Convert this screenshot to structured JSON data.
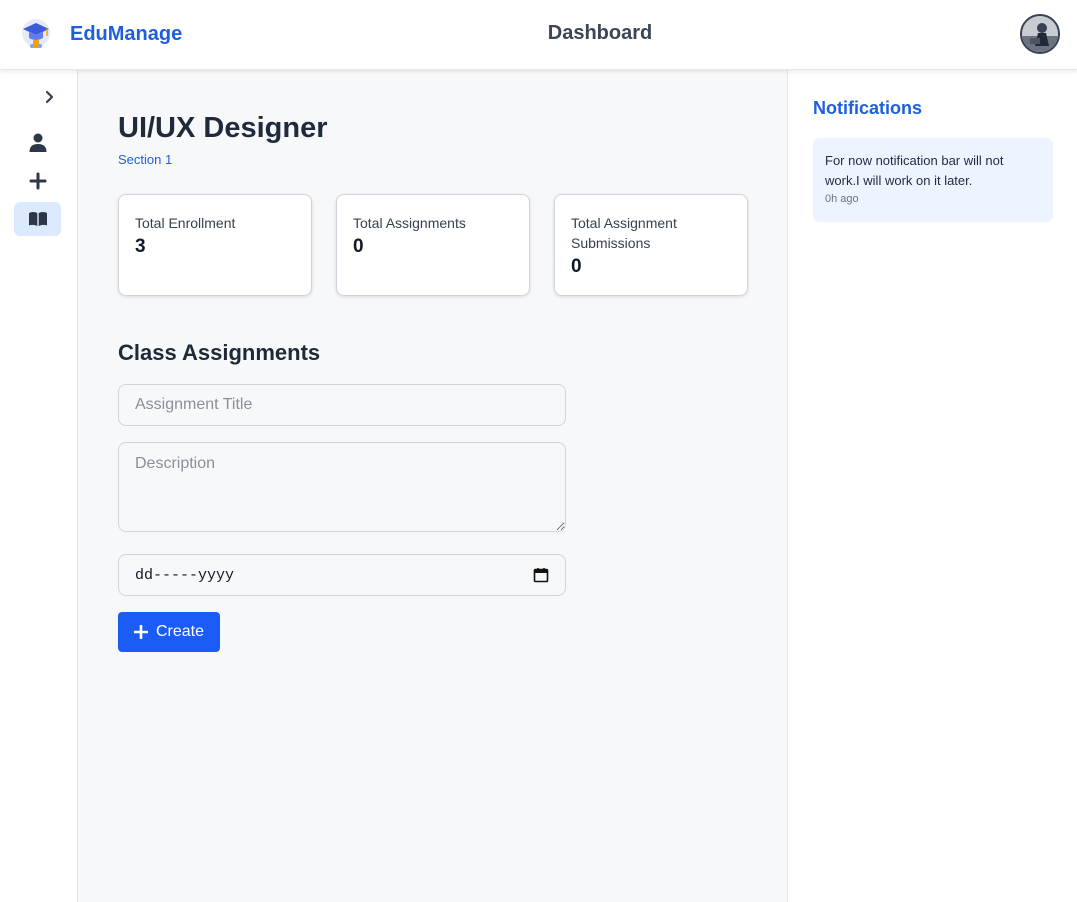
{
  "header": {
    "brand_name": "EduManage",
    "page_title": "Dashboard",
    "brand_color": "#1d5fdd"
  },
  "sidebar": {
    "items": [
      {
        "icon": "user-icon",
        "active": false
      },
      {
        "icon": "plus-icon",
        "active": false
      },
      {
        "icon": "book-open-icon",
        "active": true
      }
    ]
  },
  "course": {
    "title": "UI/UX Designer",
    "section": "Section 1"
  },
  "stats": [
    {
      "label": "Total Enrollment",
      "value": "3"
    },
    {
      "label": "Total Assignments",
      "value": "0"
    },
    {
      "label": "Total Assignment Submissions",
      "value": "0"
    }
  ],
  "assignments": {
    "heading": "Class Assignments",
    "title_placeholder": "Assignment Title",
    "description_placeholder": "Description",
    "date_placeholder": "dd-----yyyy",
    "create_label": "Create",
    "button_color": "#1c5cf6"
  },
  "notifications": {
    "heading": "Notifications",
    "items": [
      {
        "message": "For now notification bar will not work.I will work on it later.",
        "time": "0h ago"
      }
    ]
  }
}
